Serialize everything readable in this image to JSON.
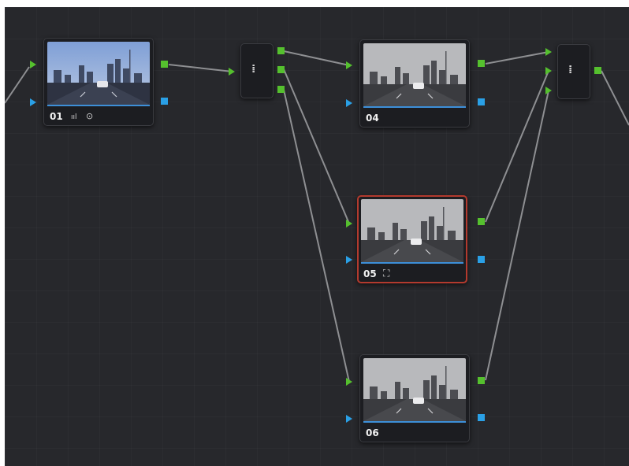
{
  "editor": {
    "background": "#27282c",
    "wire_color": "#8e8f92",
    "colors": {
      "rgb_port": "#55c02e",
      "alpha_port": "#2aa0e6",
      "selected_border": "#b33a2e",
      "thumb_underline": "#3d8fd8"
    }
  },
  "nodes": [
    {
      "id": "01",
      "label": "01",
      "color_thumbnail": true,
      "selected": false,
      "icons": [
        "waveform-icon",
        "power-icon"
      ],
      "icon_glyphs": [
        "ııl",
        "⊙"
      ]
    },
    {
      "id": "04",
      "label": "04",
      "color_thumbnail": false,
      "selected": false,
      "icons": [],
      "icon_glyphs": []
    },
    {
      "id": "05",
      "label": "05",
      "color_thumbnail": false,
      "selected": true,
      "icons": [
        "tracker-icon"
      ],
      "icon_glyphs": [
        "⛶"
      ]
    },
    {
      "id": "06",
      "label": "06",
      "color_thumbnail": false,
      "selected": false,
      "icons": [],
      "icon_glyphs": []
    }
  ],
  "splitter": {
    "glyph": "⁞",
    "outputs": 3
  },
  "combiner": {
    "glyph": "⁞",
    "inputs": 3
  }
}
